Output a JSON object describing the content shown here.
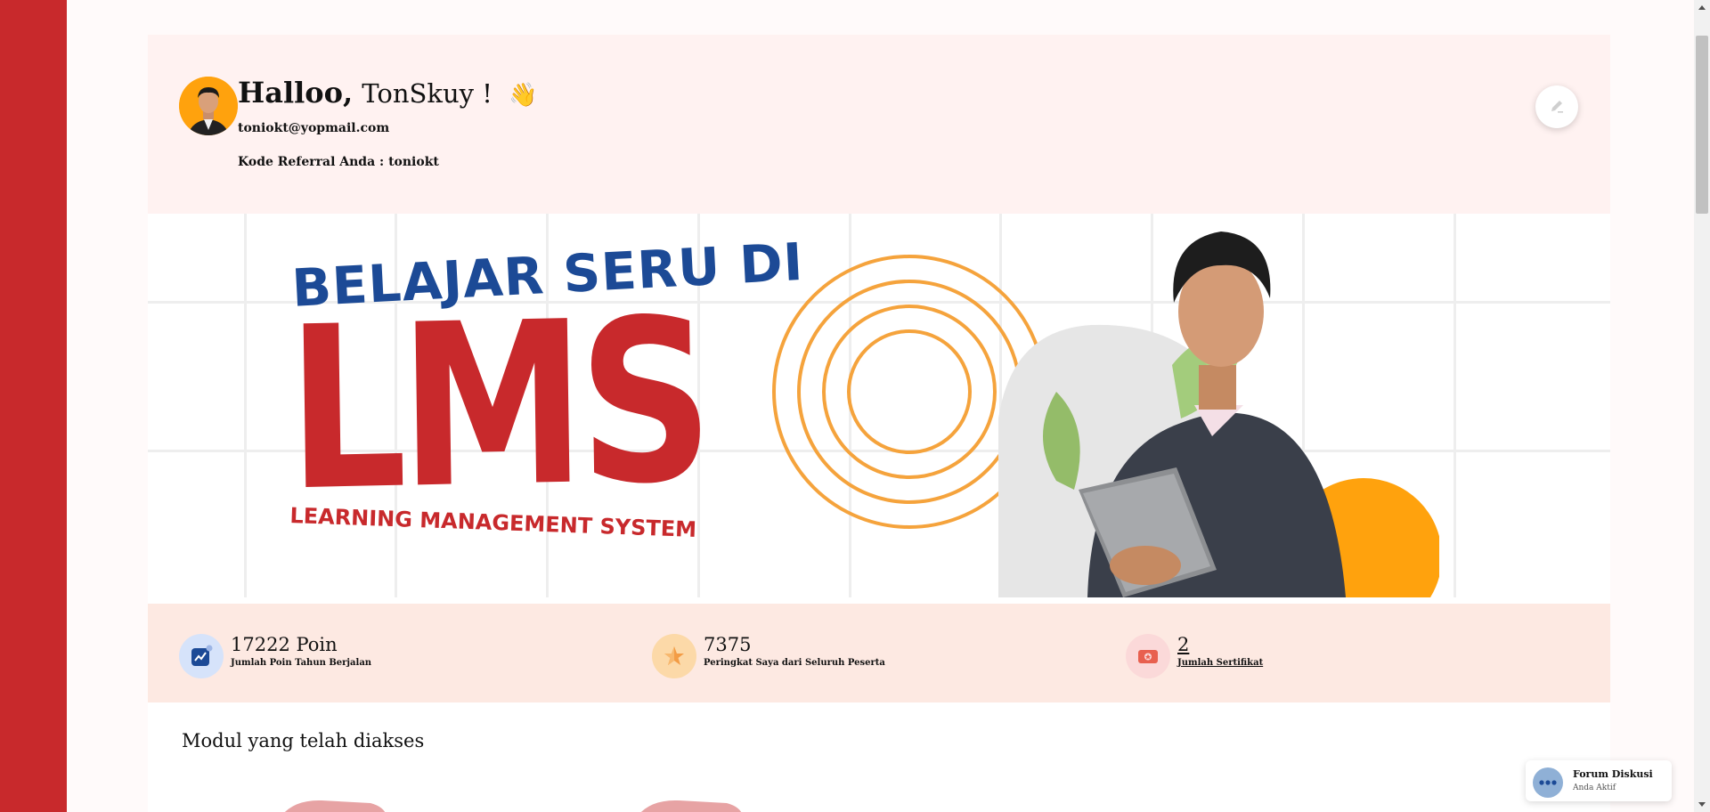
{
  "profile": {
    "greeting_hello": "Halloo,",
    "greeting_name": "TonSkuy !",
    "wave_emoji": "👋",
    "email": "toniokt@yopmail.com",
    "referral": "Kode Referral Anda : toniokt",
    "edit_icon": "pencil-icon"
  },
  "banner": {
    "title_top": "BELAJAR SERU DI",
    "title_main": "LMS",
    "subtitle": "LEARNING MANAGEMENT SYSTEM"
  },
  "stats": [
    {
      "value": "17222 Poin",
      "label": "Jumlah Poin Tahun Berjalan",
      "icon": "chart-icon",
      "color": "#1c4a96"
    },
    {
      "value": "7375",
      "label": "Peringkat Saya dari Seluruh Peserta",
      "icon": "star-icon",
      "color": "#f39c45"
    },
    {
      "value": "2",
      "label": "Jumlah Sertifikat",
      "icon": "certificate-icon",
      "color": "#e8604f"
    }
  ],
  "section": {
    "modules_title": "Modul yang telah diakses"
  },
  "forum": {
    "title": "Forum Diskusi",
    "status": "Anda Aktif",
    "icon": "chat-icon"
  },
  "colors": {
    "brand_red": "#c8292c",
    "brand_blue": "#1c4a96",
    "accent_orange": "#ffa20d",
    "profile_bg": "#fff2f1",
    "stats_bg": "#fde9e2"
  }
}
